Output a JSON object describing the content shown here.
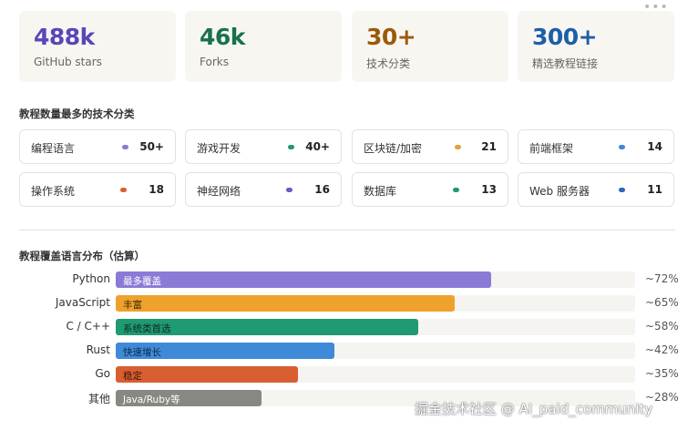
{
  "stats": [
    {
      "value": "488k",
      "label": "GitHub stars",
      "color": "#5b45b8"
    },
    {
      "value": "46k",
      "label": "Forks",
      "color": "#17714e"
    },
    {
      "value": "30+",
      "label": "技术分类",
      "color": "#9a5a0c"
    },
    {
      "value": "300+",
      "label": "精选教程链接",
      "color": "#1c5fa8"
    }
  ],
  "more_icon": "more-horizontal-icon",
  "categories_title": "教程数量最多的技术分类",
  "categories": [
    {
      "name": "编程语言",
      "count": "50+",
      "dot_color": "#8b7ad6"
    },
    {
      "name": "游戏开发",
      "count": "40+",
      "dot_color": "#1f9a73"
    },
    {
      "name": "区块链/加密",
      "count": "21",
      "dot_color": "#e6a13a"
    },
    {
      "name": "前端框架",
      "count": "14",
      "dot_color": "#3f8ad8"
    },
    {
      "name": "操作系统",
      "count": "18",
      "dot_color": "#d95f32"
    },
    {
      "name": "神经网络",
      "count": "16",
      "dot_color": "#6a5ac6"
    },
    {
      "name": "数据库",
      "count": "13",
      "dot_color": "#1f9a73"
    },
    {
      "name": "Web 服务器",
      "count": "11",
      "dot_color": "#2d67b5"
    }
  ],
  "languages_title": "教程覆盖语言分布（估算）",
  "languages": [
    {
      "name": "Python",
      "tag": "最多覆盖",
      "pct": "~72%",
      "fraction": 0.72,
      "color": "#8b7ad6",
      "tag_color": "#ffffff"
    },
    {
      "name": "JavaScript",
      "tag": "丰富",
      "pct": "~65%",
      "fraction": 0.65,
      "color": "#efa12e",
      "tag_color": "#3a2a00"
    },
    {
      "name": "C / C++",
      "tag": "系统类首选",
      "pct": "~58%",
      "fraction": 0.58,
      "color": "#1f9a73",
      "tag_color": "#0f2c21"
    },
    {
      "name": "Rust",
      "tag": "快速增长",
      "pct": "~42%",
      "fraction": 0.42,
      "color": "#3f8ad8",
      "tag_color": "#0e2744"
    },
    {
      "name": "Go",
      "tag": "稳定",
      "pct": "~35%",
      "fraction": 0.35,
      "color": "#d95f32",
      "tag_color": "#3a1405"
    },
    {
      "name": "其他",
      "tag": "Java/Ruby等",
      "pct": "~28%",
      "fraction": 0.28,
      "color": "#888782",
      "tag_color": "#ffffff"
    }
  ],
  "watermark": "掘金技术社区 @ AI_paid_community"
}
